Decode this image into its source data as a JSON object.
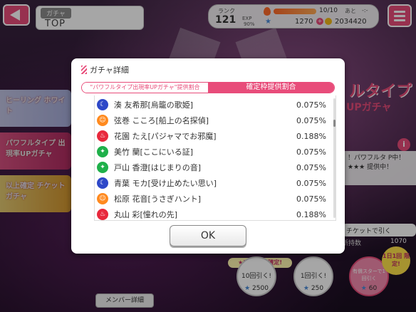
{
  "header": {
    "category": "ガチャ",
    "title": "TOP",
    "rank_label": "ランク",
    "rank": "121",
    "exp_label": "EXP",
    "exp_pct": "90%",
    "stamina": "10/10",
    "stamina_next_label": "あと",
    "stamina_time": "-:-",
    "stars": "1270",
    "coins": "2034420"
  },
  "background": {
    "banner1": "ヒーリング ホワイト",
    "banner2": "パワフルタイプ 出現率UPガチャ",
    "banner3": "以上確定 チケットガチャ",
    "right_logo": "ルタイプ",
    "right_logo2": "UPガチャ",
    "desc": "！パワフルタ P中！★★★ 提供中！",
    "ticket_btn": "チケットで引く",
    "ticket_label": "所持数",
    "ticket_count": "1070",
    "bonus_tag": "★3以上1人確定!",
    "daily_tag": "1日1回 限定!",
    "btn10_label": "10回引く!",
    "btn10_cost": "2500",
    "btn1_label": "1回引く!",
    "btn1_cost": "250",
    "btnpaid_label": "有償スターで1回引く",
    "btnpaid_cost": "60",
    "member_btn": "メンバー詳細"
  },
  "dialog": {
    "title": "ガチャ詳細",
    "tab_inactive": "\"パワフルタイプ出現率UPガチャ\"提供割合",
    "tab_active": "確定枠提供割合",
    "ok": "OK",
    "rows": [
      {
        "name": "湊 友希那[烏籠の歌姫]",
        "pct": "0.075%",
        "type": "cool"
      },
      {
        "name": "弦巻 こころ[船上の名探偵]",
        "pct": "0.075%",
        "type": "happy"
      },
      {
        "name": "花園 たえ[パジャマでお邪魔]",
        "pct": "0.188%",
        "type": "power"
      },
      {
        "name": "美竹 蘭[ここにいる証]",
        "pct": "0.075%",
        "type": "pure"
      },
      {
        "name": "戸山 香澄[はじまりの音]",
        "pct": "0.075%",
        "type": "pure"
      },
      {
        "name": "青葉 モカ[受け止めたい思い]",
        "pct": "0.075%",
        "type": "cool"
      },
      {
        "name": "松原 花音[うさぎハント]",
        "pct": "0.075%",
        "type": "happy"
      },
      {
        "name": "丸山 彩[憧れの先]",
        "pct": "0.188%",
        "type": "power"
      }
    ]
  }
}
